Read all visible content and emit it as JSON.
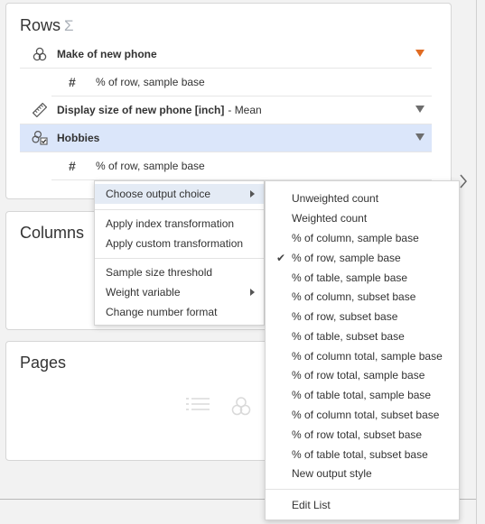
{
  "rows": {
    "title": "Rows",
    "sigma": "Σ",
    "items": [
      {
        "name": "Make of new phone",
        "stat": "",
        "icon": "multi-category-icon",
        "filter_active": true
      },
      {
        "name": "% of row, sample base",
        "type": "output"
      },
      {
        "name": "Display size of new phone [inch]",
        "stat": "- Mean",
        "icon": "ruler-icon",
        "filter_active": false
      },
      {
        "name": "Hobbies",
        "stat": "",
        "icon": "multi-response-icon",
        "filter_active": false
      },
      {
        "name": "% of row, sample base",
        "type": "output"
      }
    ]
  },
  "columns": {
    "title": "Columns"
  },
  "pages": {
    "title": "Pages"
  },
  "context_menu": {
    "items": [
      {
        "label": "Choose output choice",
        "has_submenu": true
      },
      {
        "label": "Apply index transformation"
      },
      {
        "label": "Apply custom transformation"
      },
      {
        "label": "Sample size threshold"
      },
      {
        "label": "Weight variable",
        "has_submenu": true
      },
      {
        "label": "Change number format"
      }
    ]
  },
  "submenu": {
    "items": [
      "Unweighted count",
      "Weighted count",
      "% of column, sample base",
      "% of row, sample base",
      "% of table, sample base",
      "% of column, subset base",
      "% of row, subset base",
      "% of table, subset base",
      "% of column total, sample base",
      "% of row total, sample base",
      "% of table total, sample base",
      "% of column total, subset base",
      "% of row total, subset base",
      "% of table total, subset base",
      "New output style"
    ],
    "checked": "% of row, sample base",
    "check_mark": "✔",
    "footer": "Edit List"
  },
  "colors": {
    "selected_row": "#dbe6fa",
    "filter_active": "#e06b22",
    "menu_highlight": "#e4ebf5"
  }
}
